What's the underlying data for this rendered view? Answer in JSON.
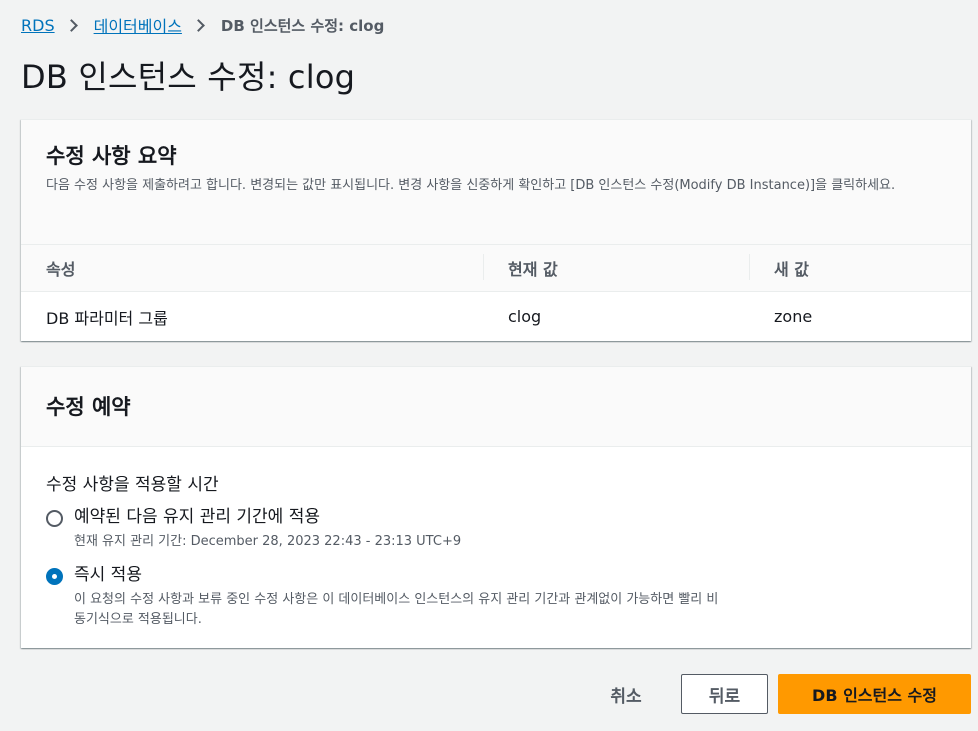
{
  "breadcrumb": {
    "items": [
      "RDS",
      "데이터베이스"
    ],
    "current": "DB 인스턴스 수정: clog"
  },
  "page_title": "DB 인스턴스 수정: clog",
  "summary": {
    "title": "수정 사항 요약",
    "description": "다음 수정 사항을 제출하려고 합니다. 변경되는 값만 표시됩니다. 변경 사항을 신중하게 확인하고 [DB 인스턴스 수정(Modify DB Instance)]을 클릭하세요.",
    "columns": [
      "속성",
      "현재 값",
      "새 값"
    ],
    "rows": [
      {
        "attribute": "DB 파라미터 그룹",
        "current": "clog",
        "new": "zone"
      }
    ]
  },
  "schedule": {
    "title": "수정 예약",
    "field_label": "수정 사항을 적용할 시간",
    "options": [
      {
        "label": "예약된 다음 유지 관리 기간에 적용",
        "description": "현재 유지 관리 기간: December 28, 2023 22:43 - 23:13 UTC+9",
        "selected": false
      },
      {
        "label": "즉시 적용",
        "description": "이 요청의 수정 사항과 보류 중인 수정 사항은 이 데이터베이스 인스턴스의 유지 관리 기간과 관계없이 가능하면 빨리 비동기식으로 적용됩니다.",
        "selected": true
      }
    ]
  },
  "footer": {
    "cancel_label": "취소",
    "back_label": "뒤로",
    "submit_label": "DB 인스턴스 수정"
  },
  "colors": {
    "accent": "#0073bb",
    "primary_button": "#ff9900",
    "background": "#f2f3f3"
  }
}
